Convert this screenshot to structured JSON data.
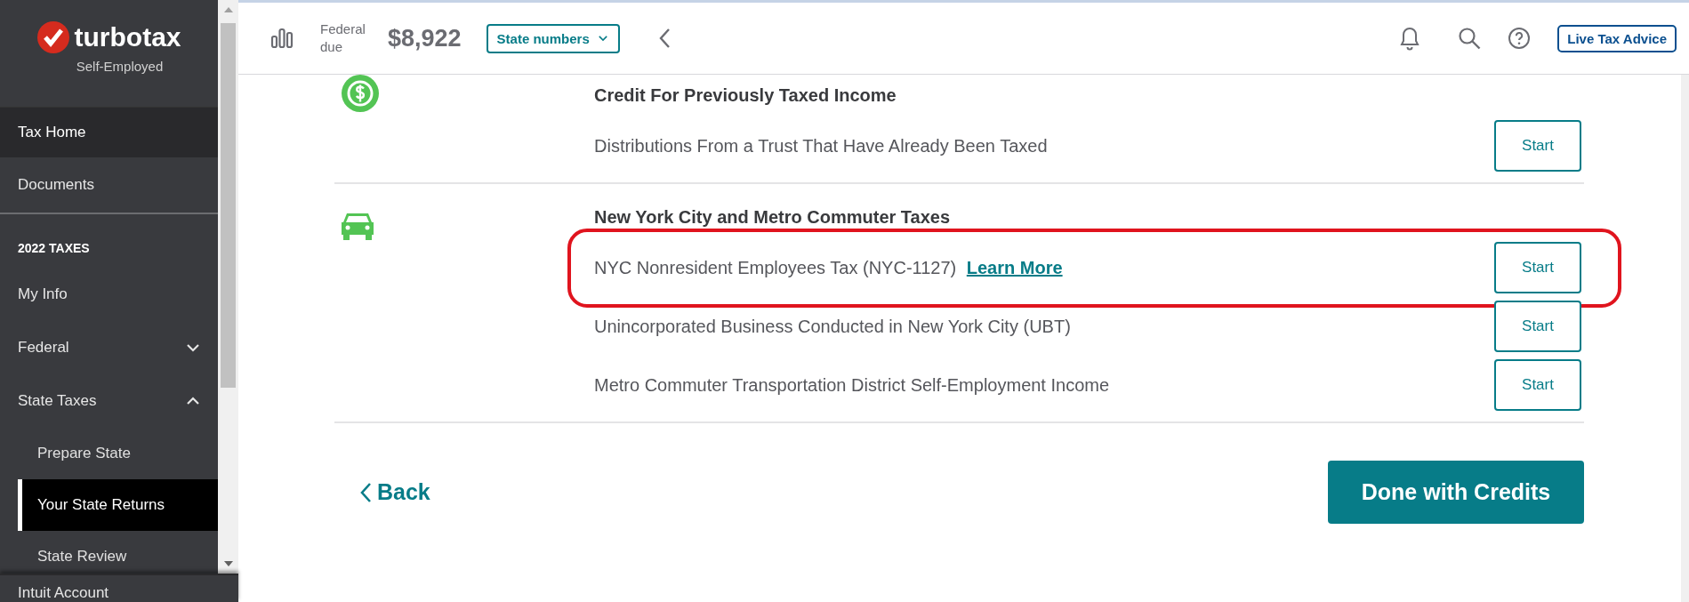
{
  "sidebar": {
    "brand": "turbotax",
    "edition": "Self-Employed",
    "top_items": [
      {
        "label": "Tax Home",
        "hovered": true
      },
      {
        "label": "Documents",
        "hovered": false
      }
    ],
    "section_title": "2022 TAXES",
    "items": [
      {
        "label": "My Info",
        "selected": false
      },
      {
        "label": "Federal",
        "expanded": false,
        "selected": false
      },
      {
        "label": "State Taxes",
        "expanded": true,
        "selected": false,
        "children": [
          {
            "label": "Prepare State",
            "selected": false
          },
          {
            "label": "Your State Returns",
            "selected": true
          },
          {
            "label": "State Review",
            "selected": false
          }
        ]
      }
    ],
    "footer_item": "Intuit Account"
  },
  "header": {
    "federal_label": "Federal due",
    "federal_amount": "$8,922",
    "state_dropdown": "State numbers",
    "advice_button": "Live Tax Advice"
  },
  "sections": [
    {
      "kind": "money",
      "title": "Credit For Previously Taxed Income",
      "rows": [
        {
          "label": "Distributions From a Trust That Have Already Been Taxed",
          "button": "Start",
          "highlighted": false
        }
      ]
    },
    {
      "kind": "car",
      "title": "New York City and Metro Commuter Taxes",
      "rows": [
        {
          "label": "NYC Nonresident Employees Tax (NYC-1127)",
          "link": "Learn More",
          "button": "Start",
          "highlighted": true
        },
        {
          "label": "Unincorporated Business Conducted in New York City (UBT)",
          "button": "Start",
          "highlighted": false
        },
        {
          "label": "Metro Commuter Transportation District Self-Employment Income",
          "button": "Start",
          "highlighted": false
        }
      ]
    }
  ],
  "back_link": "Back",
  "done_button": "Done with Credits"
}
